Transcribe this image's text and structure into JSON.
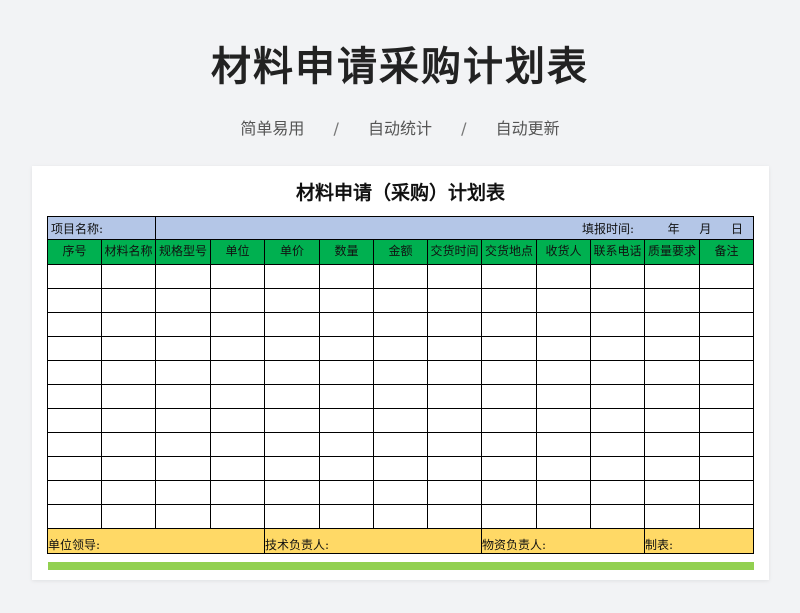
{
  "page": {
    "title": "材料申请采购计划表",
    "tags": [
      "简单易用",
      "自动统计",
      "自动更新"
    ],
    "separator": "/"
  },
  "sheet": {
    "title": "材料申请（采购）计划表",
    "project_label": "项目名称:",
    "report_time_label": "填报时间:",
    "year": "年",
    "month": "月",
    "day": "日",
    "columns": [
      "序号",
      "材料名称",
      "规格型号",
      "单位",
      "单价",
      "数量",
      "金额",
      "交货时间",
      "交货地点",
      "收货人",
      "联系电话",
      "质量要求",
      "备注"
    ],
    "body_rows": 11,
    "footer": {
      "leader": "单位领导:",
      "tech": "技术负责人:",
      "material": "物资负责人:",
      "maker": "制表:"
    },
    "colors": {
      "info": "#b4c6e7",
      "header": "#00b050",
      "footer": "#ffd966",
      "bottom_bar": "#92d050"
    }
  }
}
